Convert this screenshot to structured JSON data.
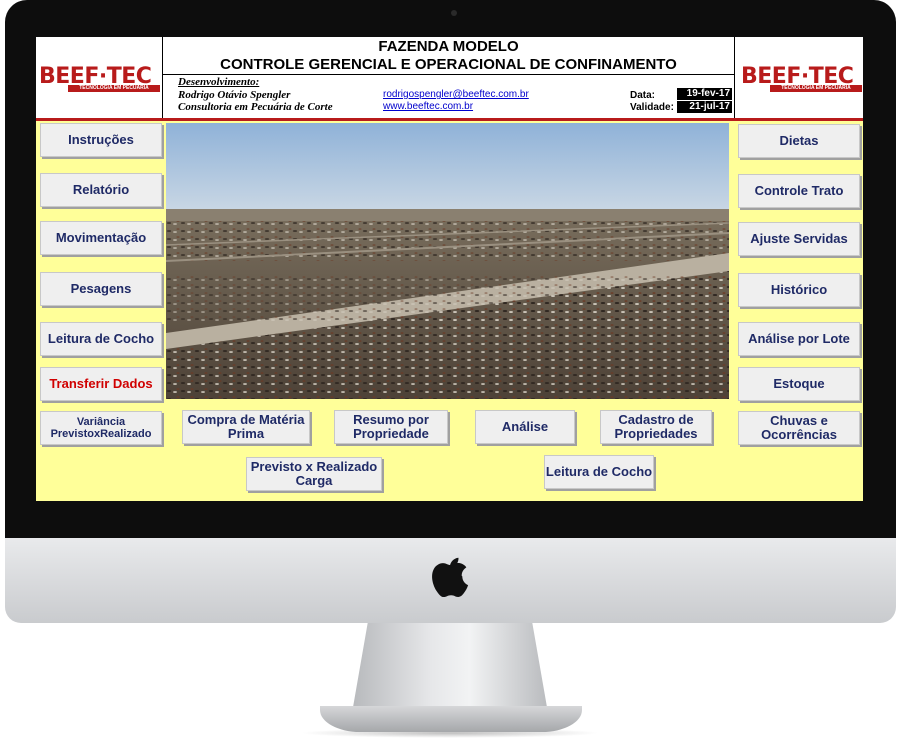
{
  "header": {
    "title": "FAZENDA MODELO",
    "subtitle": "CONTROLE GERENCIAL E OPERACIONAL DE CONFINAMENTO",
    "logo_text": "BEEF·TEC",
    "logo_sub": "TECNOLOGIA EM PECUÁRIA",
    "dev_label": "Desenvolvimento:",
    "dev_name": "Rodrigo Otávio Spengler",
    "dev_org": "Consultoria em Pecuária de Corte",
    "email": "rodrigospengler@beeftec.com.br",
    "site": "www.beeftec.com.br",
    "date_label": "Data:",
    "date_value": "19-fev-17",
    "validity_label": "Validade:",
    "validity_value": "21-jul-17"
  },
  "left_buttons": [
    "Instruções",
    "Relatório",
    "Movimentação",
    "Pesagens",
    "Leitura de Cocho",
    "Transferir Dados"
  ],
  "right_buttons": [
    "Dietas",
    "Controle Trato",
    "Ajuste Servidas",
    "Histórico",
    "Análise por Lote",
    "Estoque"
  ],
  "bottom_buttons": {
    "variancia": "Variância PrevistoxRealizado",
    "compra": "Compra de Matéria Prima",
    "resumo": "Resumo por Propriedade",
    "analise": "Análise",
    "cadastro": "Cadastro de Propriedades",
    "chuvas": "Chuvas e Ocorrências",
    "previsto": "Previsto x Realizado Carga",
    "leitura": "Leitura de Cocho"
  },
  "colors": {
    "background": "#ffff99",
    "brand_red": "#b81b1b",
    "button_text": "#1f2a66",
    "alert_text": "#d00000"
  }
}
